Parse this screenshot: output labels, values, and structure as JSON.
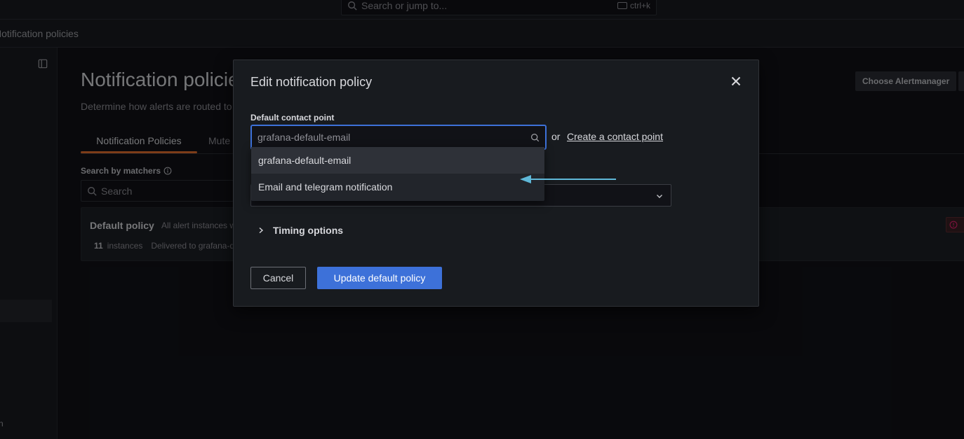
{
  "topbar": {
    "search_placeholder": "Search or jump to...",
    "shortcut": "ctrl+k"
  },
  "breadcrumb": {
    "current": "Notification policies"
  },
  "page": {
    "title": "Notification policies",
    "subtitle": "Determine how alerts are routed to contact points",
    "choose_alertmanager": "Choose Alertmanager",
    "tabs": [
      {
        "label": "Notification Policies"
      },
      {
        "label": "Mute Timings"
      }
    ],
    "matchers_label": "Search by matchers",
    "search_placeholder": "Search",
    "default_policy": {
      "title": "Default policy",
      "description": "All alert instances will be handled by the default policy if no other matching policies are found.",
      "instances_count": "11",
      "instances_label": "instances",
      "delivered": "Delivered to grafana-default-email"
    },
    "sidebar_bottom_letter": "n"
  },
  "modal": {
    "title": "Edit notification policy",
    "contact_label": "Default contact point",
    "contact_placeholder": "grafana-default-email",
    "or_text": "or",
    "create_link": "Create a contact point",
    "options": [
      "grafana-default-email",
      "Email and telegram notification"
    ],
    "timing_label": "Timing options",
    "cancel_label": "Cancel",
    "submit_label": "Update default policy"
  },
  "colors": {
    "primary": "#3d71d9",
    "tab_accent": "#e46f2e",
    "annotation_arrow": "#5fb8d8",
    "error": "#e0226e"
  },
  "icons": [
    "search-icon",
    "close-icon",
    "chevron-down-icon",
    "chevron-right-icon",
    "info-icon",
    "dock-icon",
    "arrow-annotation"
  ]
}
